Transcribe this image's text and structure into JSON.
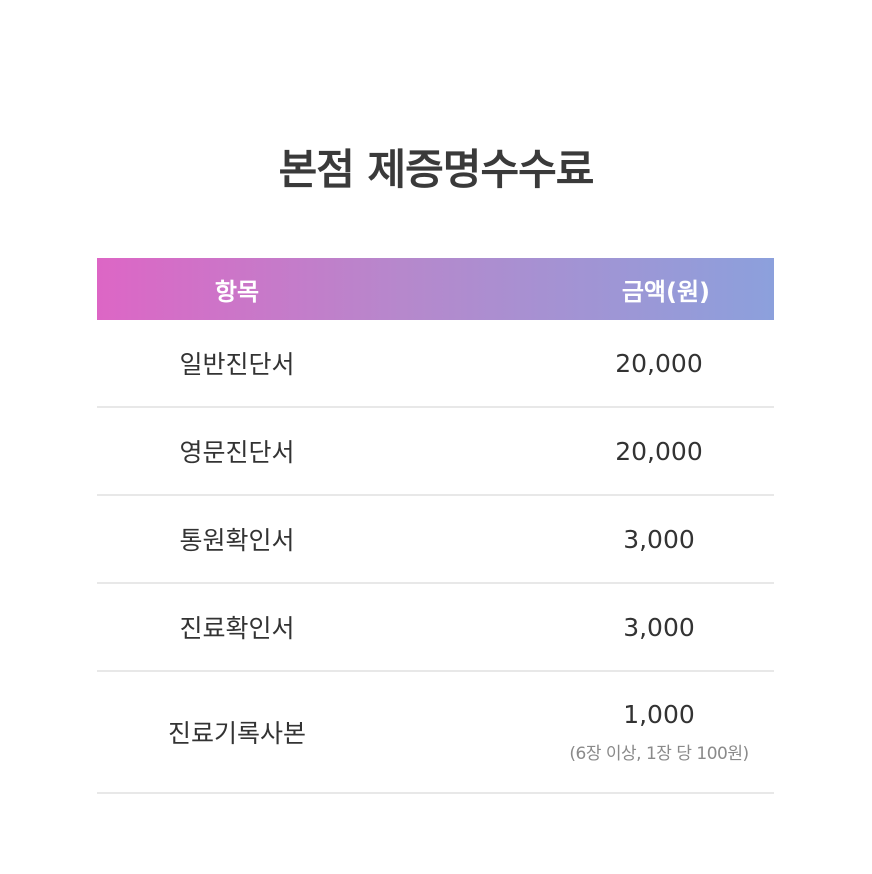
{
  "title": "본점 제증명수수료",
  "table": {
    "header": {
      "item": "항목",
      "price": "금액(원)"
    },
    "rows": [
      {
        "item": "일반진단서",
        "price": "20,000"
      },
      {
        "item": "영문진단서",
        "price": "20,000"
      },
      {
        "item": "통원확인서",
        "price": "3,000"
      },
      {
        "item": "진료확인서",
        "price": "3,000"
      },
      {
        "item": "진료기록사본",
        "price": "1,000",
        "note": "(6장 이상, 1장 당 100원)"
      }
    ]
  },
  "colors": {
    "header_gradient_start": "#dd66c5",
    "header_gradient_end": "#8ca0dc",
    "divider": "#e8e8e8"
  }
}
